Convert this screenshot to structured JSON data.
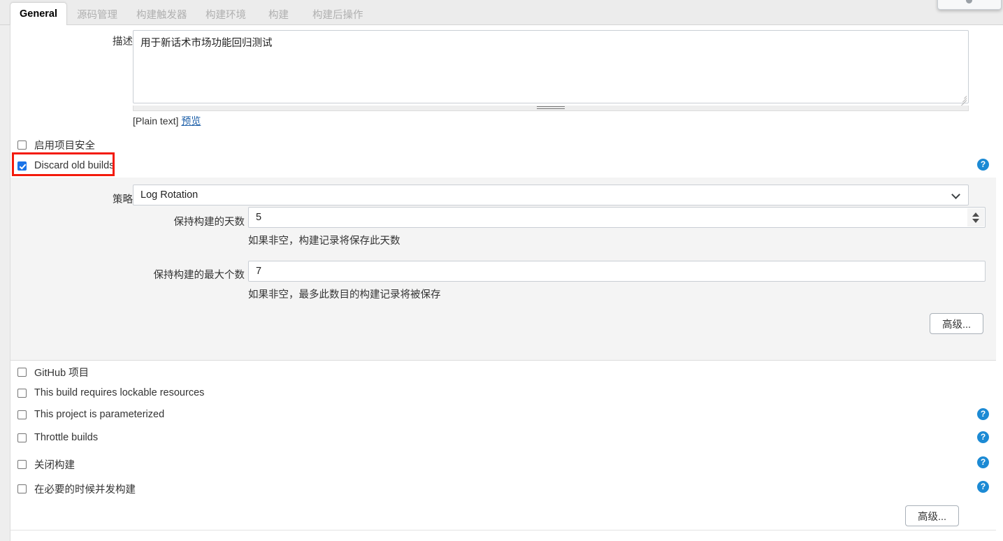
{
  "tabs": [
    {
      "label": "General",
      "active": true
    },
    {
      "label": "源码管理",
      "active": false
    },
    {
      "label": "构建触发器",
      "active": false
    },
    {
      "label": "构建环境",
      "active": false
    },
    {
      "label": "构建",
      "active": false
    },
    {
      "label": "构建后操作",
      "active": false
    }
  ],
  "description": {
    "label": "描述",
    "value": "用于新话术市场功能回归测试",
    "placeholder": "",
    "markup_note": "[Plain text]",
    "preview_link": "预览"
  },
  "top_checkboxes": [
    {
      "label": "启用项目安全",
      "checked": false
    },
    {
      "label": "Discard old builds",
      "checked": true,
      "highlighted": true
    }
  ],
  "log_rotation": {
    "strategy": {
      "label": "策略",
      "value": "Log Rotation",
      "options": [
        "Log Rotation"
      ]
    },
    "days_to_keep": {
      "label": "保持构建的天数",
      "value": "5",
      "help": "如果非空，构建记录将保存此天数"
    },
    "max_builds": {
      "label": "保持构建的最大个数",
      "value": "7",
      "help": "如果非空，最多此数目的构建记录将被保存"
    },
    "advanced_label": "高级..."
  },
  "bottom_checkboxes": [
    {
      "label": "GitHub 项目",
      "checked": false,
      "help": false
    },
    {
      "label": "This build requires lockable resources",
      "checked": false,
      "help": false
    },
    {
      "label": "This project is parameterized",
      "checked": false,
      "help": true
    },
    {
      "label": "Throttle builds",
      "checked": false,
      "help": true
    },
    {
      "label": "关闭构建",
      "checked": false,
      "help": true
    },
    {
      "label": "在必要的时候并发构建",
      "checked": false,
      "help": true
    }
  ],
  "bottom_advanced_label": "高级...",
  "icons": {
    "help": "?",
    "chevron_down": "chevron-down-icon",
    "spinner": "number-spinner-icon",
    "resize_grip": "resize-grip-icon"
  },
  "colors": {
    "accent_checkbox": "#1a73e8",
    "highlight_box": "#f31b0c",
    "help_icon": "#1c8ad4",
    "link": "#1d5fa8",
    "panel_bg": "#f4f4f4",
    "tabbar_bg": "#ececec"
  }
}
